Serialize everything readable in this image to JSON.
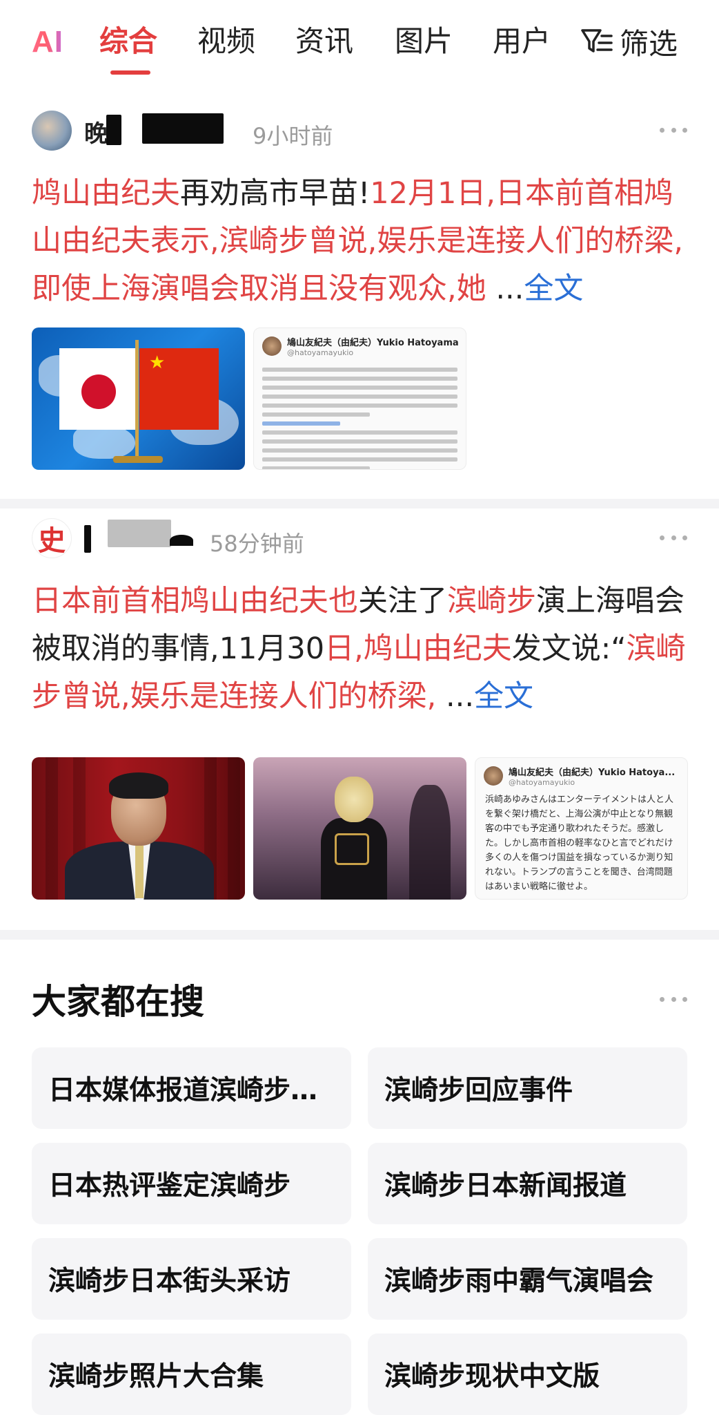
{
  "topbar": {
    "logo": "AI",
    "tabs": [
      "综合",
      "视频",
      "资讯",
      "图片",
      "用户"
    ],
    "filter_label": "筛选",
    "filter_icon": "filter-icon"
  },
  "colors": {
    "accent": "#e33e3e",
    "highlight": "#e04444",
    "link": "#2a6fd6",
    "meta": "#9b9b9b"
  },
  "posts": [
    {
      "author": "晚",
      "time": "9小时前",
      "summary": {
        "p1": "鸠山由纪夫",
        "p2": "再劝高市早苗!",
        "p3": "12月1日,日本前首相鸠山由纪夫表示,滨崎步曾说,娱乐是连接人们的桥梁,即使上海演唱会取消且没有观众,她",
        "ellipsis": " ...",
        "more": "全文"
      },
      "images": [
        "flags-on-map",
        "tweet-screenshot"
      ],
      "tweet": {
        "name": "鳩山友紀夫（由紀夫）Yukio Hatoyama",
        "handle": "@hatoyamayukio"
      }
    },
    {
      "author": "",
      "time": "58分钟前",
      "summary": {
        "p1": "日本前首相鸠山由纪夫也",
        "p2": "关注了",
        "p3": "滨崎步",
        "p4": "演上海唱会被取消的事情,11月30",
        "p5": "日,鸠山由纪夫",
        "p6": "发文说:“",
        "p7": "滨崎步曾说,娱乐是连接人们的桥梁,",
        "ellipsis": " ...",
        "more": "全文"
      },
      "images": [
        "portrait-photo",
        "concert-photo",
        "tweet-screenshot"
      ],
      "tweet": {
        "name": "鳩山友紀夫（由紀夫）Yukio Hatoya...",
        "handle": "@hatoyamayukio",
        "text": "浜崎あゆみさんはエンターテイメントは人と人を繋ぐ架け橋だと、上海公演が中止となり無観客の中でも予定通り歌われたそうだ。感激した。しかし高市首相の軽率なひと言でどれだけ多くの人を傷つけ国益を損なっているか測り知れない。トランプの言うことを聞き、台湾問題はあいまい戦略に徹せよ。"
      }
    }
  ],
  "search_section": {
    "title": "大家都在搜",
    "items": [
      "日本媒体报道滨崎步…",
      "滨崎步回应事件",
      "日本热评鉴定滨崎步",
      "滨崎步日本新闻报道",
      "滨崎步日本街头采访",
      "滨崎步雨中霸气演唱会",
      "滨崎步照片大合集",
      "滨崎步现状中文版"
    ]
  }
}
